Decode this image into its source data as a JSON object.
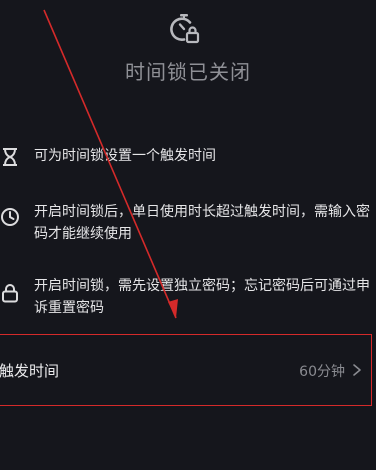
{
  "header": {
    "icon": "timer-lock-icon",
    "title": "时间锁已关闭"
  },
  "info_items": [
    {
      "icon": "hourglass-icon",
      "text": "可为时间锁设置一个触发时间"
    },
    {
      "icon": "clock-icon",
      "text": "开启时间锁后，单日使用时长超过触发时间，需输入密码才能继续使用"
    },
    {
      "icon": "lock-icon",
      "text": "开启时间锁，需先设置独立密码；忘记密码后可通过申诉重置密码"
    }
  ],
  "trigger_setting": {
    "label": "触发时间",
    "value": "60分钟",
    "chevron_icon": "chevron-right-icon"
  },
  "colors": {
    "background": "#15161c",
    "title_text": "#8f9096",
    "body_text": "#e6e6e8",
    "secondary_text": "#8a8b91",
    "annotation_red": "#d42a2a"
  }
}
